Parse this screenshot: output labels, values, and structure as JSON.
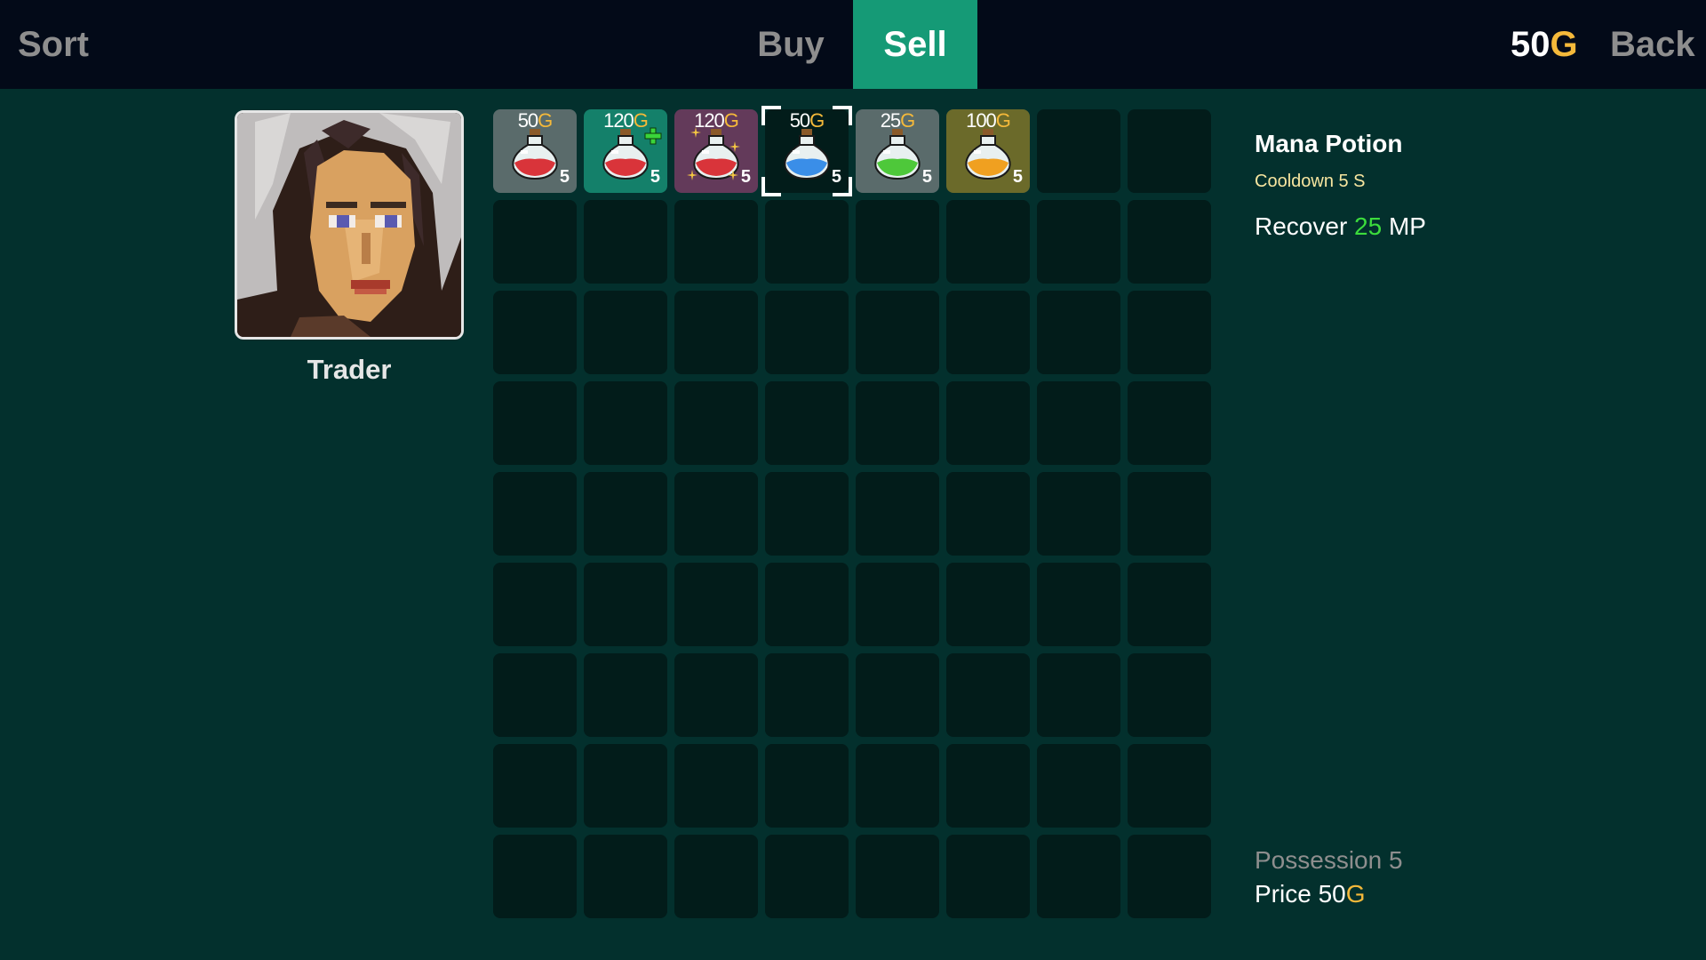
{
  "topbar": {
    "sort_label": "Sort",
    "tabs": [
      {
        "label": "Buy",
        "active": false
      },
      {
        "label": "Sell",
        "active": true
      }
    ],
    "gold_amount": "50",
    "gold_unit": "G",
    "back_label": "Back"
  },
  "trader": {
    "name": "Trader"
  },
  "inventory": {
    "columns": 8,
    "rows": 9,
    "selected_index": 3,
    "items": [
      {
        "price": "50",
        "unit": "G",
        "qty": "5",
        "color": "#d9343a",
        "slot_bg": "#5a6b6b",
        "icon": "health-potion-icon",
        "badge": ""
      },
      {
        "price": "120",
        "unit": "G",
        "qty": "5",
        "color": "#d9343a",
        "slot_bg": "#14806a",
        "icon": "health-potion-icon",
        "badge": "plus"
      },
      {
        "price": "120",
        "unit": "G",
        "qty": "5",
        "color": "#d9343a",
        "slot_bg": "#633a5a",
        "icon": "health-potion-icon",
        "badge": "sparkle"
      },
      {
        "price": "50",
        "unit": "G",
        "qty": "5",
        "color": "#3a8ee8",
        "slot_bg": "#021c1a",
        "icon": "mana-potion-icon",
        "badge": ""
      },
      {
        "price": "25",
        "unit": "G",
        "qty": "5",
        "color": "#4ec83a",
        "slot_bg": "#5a6b6b",
        "icon": "stamina-potion-icon",
        "badge": ""
      },
      {
        "price": "100",
        "unit": "G",
        "qty": "5",
        "color": "#f0a020",
        "slot_bg": "#6b6a2a",
        "icon": "strength-potion-icon",
        "badge": ""
      }
    ]
  },
  "details": {
    "name": "Mana Potion",
    "cooldown": "Cooldown 5 S",
    "recover_prefix": "Recover",
    "recover_amount": "25",
    "recover_suffix": "MP",
    "possession": "Possession 5",
    "price_prefix": "Price",
    "price_value": "50",
    "price_unit": "G"
  },
  "colors": {
    "background": "#03302d",
    "topbar": "#030a18",
    "sell_tab_active": "#159a76",
    "gold_accent": "#f5b93a",
    "recover_green": "#3cdc3c",
    "empty_slot": "#021c1a"
  }
}
